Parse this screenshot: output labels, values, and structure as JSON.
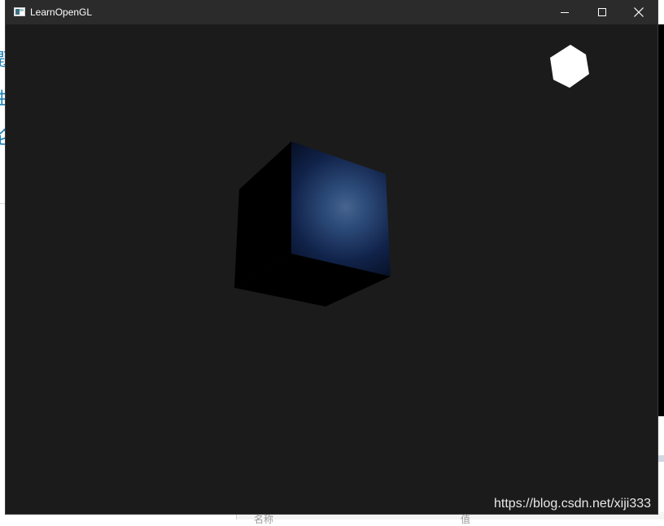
{
  "window": {
    "title": "LearnOpenGL",
    "controls": [
      "minimize-icon",
      "maximize-icon",
      "close-icon"
    ]
  },
  "scene": {
    "background_color": "#1b1b1b",
    "cube_color": "#000000",
    "highlight_color": "#3f5d86",
    "lamp_color": "#ffffff"
  },
  "watermark": "https://blog.csdn.net/xiji333",
  "background_app": {
    "left_glyphs": [
      "题",
      "曲",
      "仑"
    ],
    "bottom_labels": [
      "名称",
      "值"
    ]
  }
}
